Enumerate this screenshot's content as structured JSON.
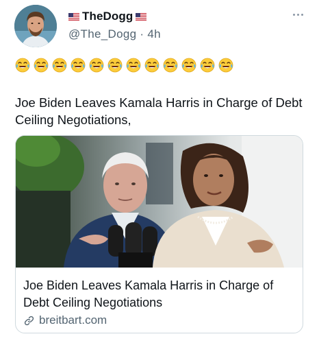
{
  "author": {
    "display_name": "TheDogg",
    "handle": "@The_Dogg",
    "separator": "·",
    "timestamp": "4h",
    "name_prefix_flag": "us-flag-icon",
    "name_suffix_flag": "us-flag-icon"
  },
  "post": {
    "emoji_line": {
      "emoji": "face-with-tears-of-joy",
      "count": 12
    },
    "text": "Joe Biden Leaves Kamala Harris in Charge of Debt Ceiling Negotiations,"
  },
  "link_card": {
    "title": "Joe Biden Leaves Kamala Harris in Charge of Debt Ceiling Negotiations",
    "domain": "breitbart.com",
    "domain_icon": "link-icon"
  },
  "colors": {
    "text_primary": "#0f1419",
    "text_secondary": "#536471",
    "card_border": "#cfd9de"
  }
}
